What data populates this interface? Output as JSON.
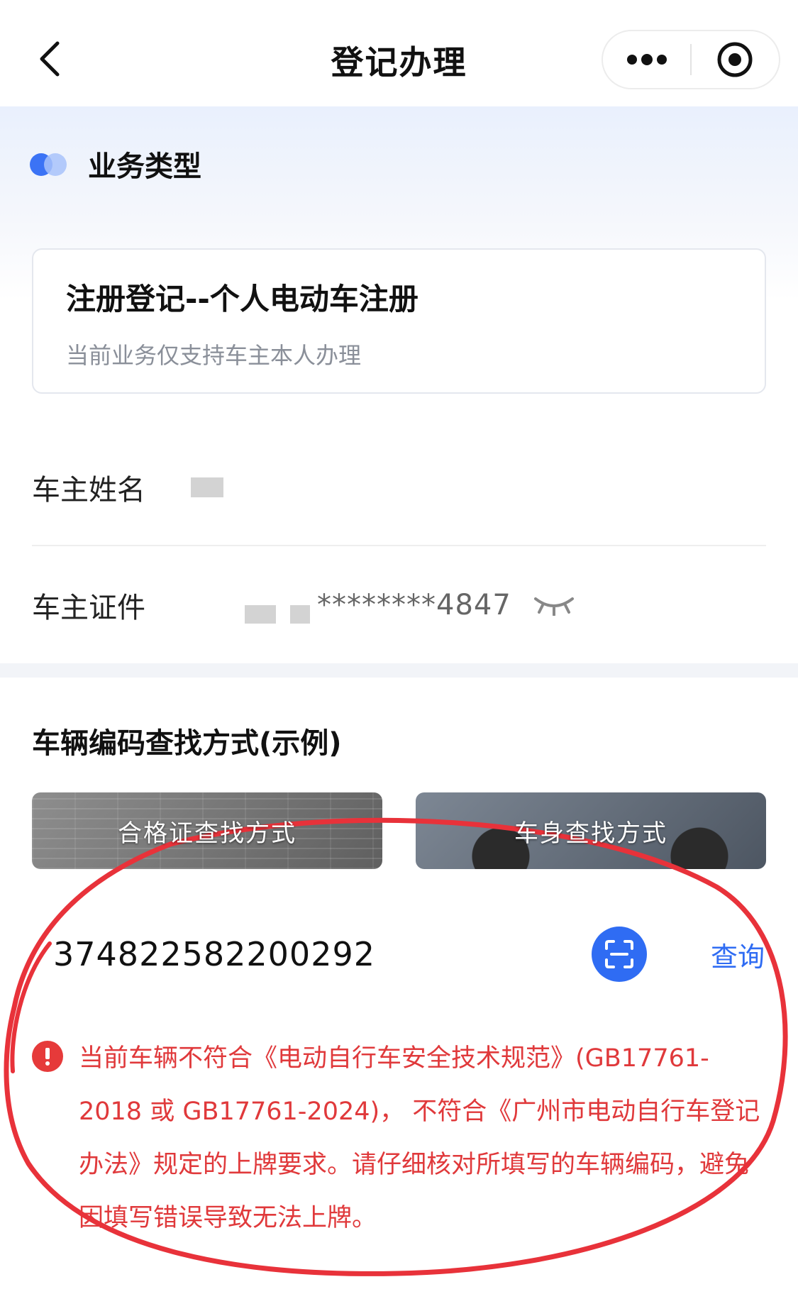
{
  "header": {
    "title": "登记办理",
    "back_icon": "chevron-left-icon",
    "more_icon": "more-dots-icon",
    "close_icon": "target-close-icon"
  },
  "business": {
    "section_title": "业务类型",
    "card_title": "注册登记--个人电动车注册",
    "card_note": "当前业务仅支持车主本人办理"
  },
  "owner": {
    "name_label": "车主姓名",
    "id_label": "车主证件",
    "id_value": "********4847",
    "eye_icon": "eye-closed-icon"
  },
  "vehicle": {
    "section_title": "车辆编码查找方式(示例)",
    "cert_method": "合格证查找方式",
    "body_method": "车身查找方式",
    "code_value": "374822582200292",
    "scan_icon": "scan-icon",
    "query_label": "查询",
    "error_message": "当前车辆不符合《电动自行车安全技术规范》(GB17761-2018 或 GB17761-2024)， 不符合《广州市电动自行车登记办法》规定的上牌要求。请仔细核对所填写的车辆编码，避免因填写错误导致无法上牌。"
  },
  "colors": {
    "accent": "#2f6cf3",
    "error": "#e0393b",
    "annotation": "#e8323a"
  }
}
